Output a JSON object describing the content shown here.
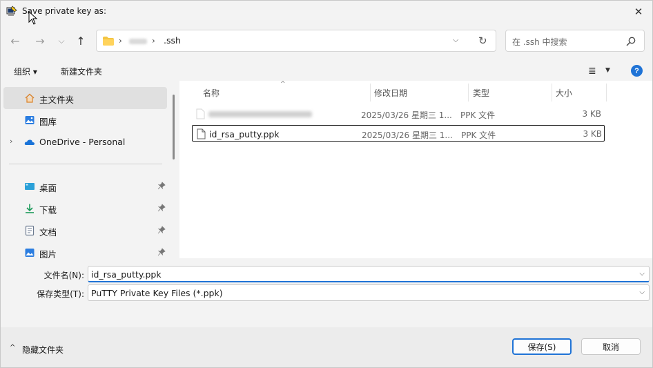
{
  "window": {
    "title": "Save private key as:",
    "close_glyph": "✕"
  },
  "nav": {
    "back_glyph": "←",
    "forward_glyph": "→",
    "recent_glyph": "⌵",
    "up_glyph": "↑",
    "breadcrumb_sep": "›",
    "breadcrumb_current": ".ssh",
    "dropdown_glyph": "⌵",
    "refresh_glyph": "↻",
    "search_placeholder": "在 .ssh 中搜索"
  },
  "toolbar": {
    "organize": "组织 ▾",
    "new_folder": "新建文件夹",
    "view_glyph": "≣",
    "view_caret": "▼",
    "help_glyph": "?"
  },
  "sidebar": {
    "items": [
      {
        "label": "主文件夹",
        "icon": "home-icon"
      },
      {
        "label": "图库",
        "icon": "gallery-icon"
      },
      {
        "label": "OneDrive - Personal",
        "icon": "onedrive-icon",
        "expander": "›"
      },
      {
        "label": "桌面",
        "icon": "desktop-icon"
      },
      {
        "label": "下载",
        "icon": "download-icon"
      },
      {
        "label": "文档",
        "icon": "documents-icon"
      },
      {
        "label": "图片",
        "icon": "pictures-icon"
      }
    ]
  },
  "columns": {
    "name": "名称",
    "modified": "修改日期",
    "type": "类型",
    "size": "大小",
    "sort_glyph": "^"
  },
  "files": [
    {
      "name": "",
      "modified": "2025/03/26 星期三 1...",
      "type": "PPK 文件",
      "size": "3 KB",
      "blurred": true
    },
    {
      "name": "id_rsa_putty.ppk",
      "modified": "2025/03/26 星期三 1...",
      "type": "PPK 文件",
      "size": "3 KB",
      "blurred": false
    }
  ],
  "form": {
    "filename_label": "文件名(N):",
    "filename_value": "id_rsa_putty.ppk",
    "filetype_label": "保存类型(T):",
    "filetype_value": "PuTTY Private Key Files (*.ppk)",
    "dropdown_glyph": "⌵"
  },
  "footer": {
    "hide_folders": "隐藏文件夹",
    "hide_caret": "^",
    "save": "保存(S)",
    "cancel": "取消"
  },
  "colors": {
    "accent": "#1f73d6",
    "selected_nav": "#e0e0e0",
    "background": "#f3f3f3"
  }
}
